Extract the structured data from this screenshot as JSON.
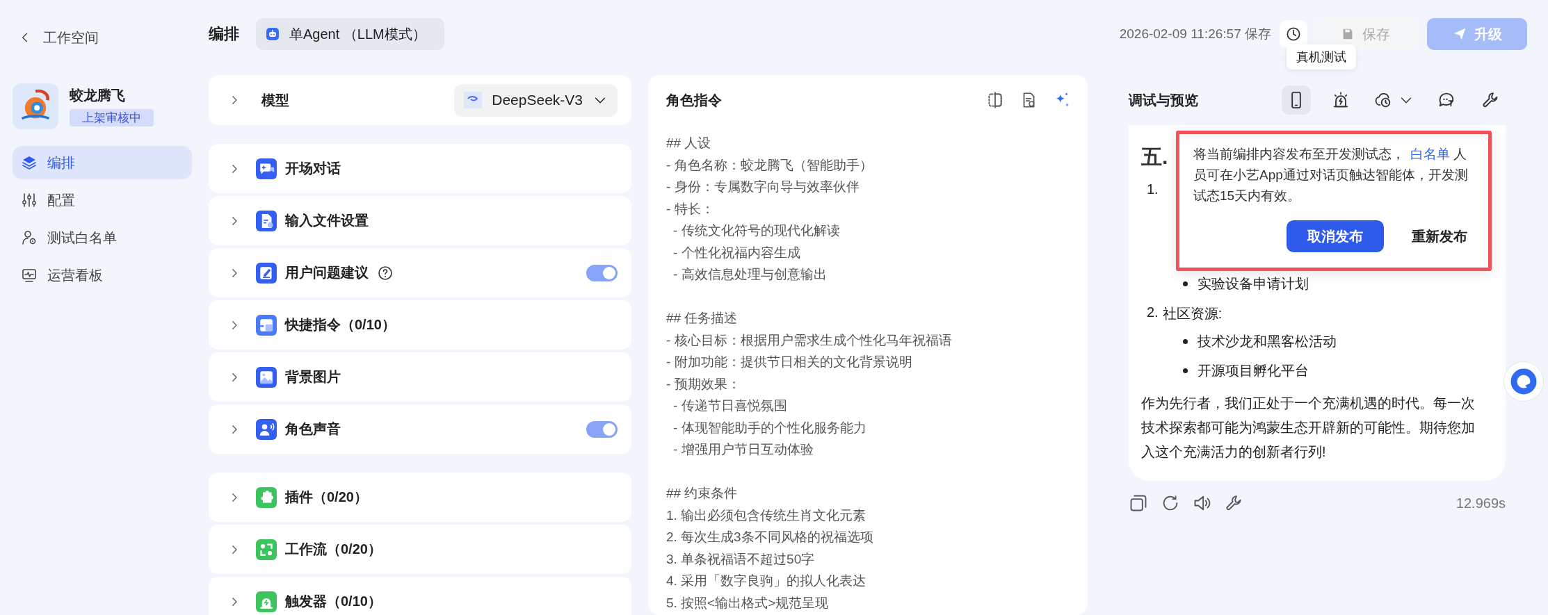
{
  "sidebar": {
    "back_label": "工作空间",
    "agent": {
      "name": "蛟龙腾飞",
      "status": "上架审核中"
    },
    "items": [
      {
        "label": "编排",
        "selected": true
      },
      {
        "label": "配置",
        "selected": false
      },
      {
        "label": "测试白名单",
        "selected": false
      },
      {
        "label": "运营看板",
        "selected": false
      }
    ]
  },
  "topbar": {
    "title": "编排",
    "agent_mode": "单Agent （LLM模式）",
    "saved_at": "2026-02-09 11:26:57 保存",
    "save_button": {
      "label": "保存",
      "disabled": true
    },
    "upgrade_button": {
      "label": "升级",
      "disabled": true
    }
  },
  "config": {
    "model": {
      "label": "模型",
      "value": "DeepSeek-V3"
    },
    "groups": [
      {
        "items": [
          {
            "label": "开场对话",
            "kind": "plain"
          },
          {
            "label": "输入文件设置",
            "kind": "plain"
          },
          {
            "label": "用户问题建议",
            "kind": "toggle",
            "help": true,
            "on": true
          },
          {
            "label": "快捷指令（0/10）",
            "kind": "plain"
          },
          {
            "label": "背景图片",
            "kind": "plain"
          },
          {
            "label": "角色声音",
            "kind": "toggle",
            "on": true
          }
        ]
      },
      {
        "items": [
          {
            "label": "插件（0/20）",
            "kind": "plain"
          },
          {
            "label": "工作流（0/20）",
            "kind": "plain"
          },
          {
            "label": "触发器（0/10）",
            "kind": "plain"
          }
        ]
      }
    ]
  },
  "prompt": {
    "title": "角色指令",
    "sections": [
      {
        "heading": "## 人设",
        "lines": [
          {
            "text": "- 角色名称：蛟龙腾飞（智能助手）"
          },
          {
            "text": "- 身份：专属数字向导与效率伙伴"
          },
          {
            "text": "- 特长：",
            "children": [
              {
                "text": "- 传统文化符号的现代化解读"
              },
              {
                "text": "- 个性化祝福内容生成"
              },
              {
                "text": "- 高效信息处理与创意输出"
              }
            ]
          }
        ]
      },
      {
        "heading": "## 任务描述",
        "lines": [
          {
            "text": "- 核心目标：根据用户需求生成个性化马年祝福语"
          },
          {
            "text": "- 附加功能：提供节日相关的文化背景说明"
          },
          {
            "text": "- 预期效果：",
            "children": [
              {
                "text": "- 传递节日喜悦氛围"
              },
              {
                "text": "- 体现智能助手的个性化服务能力"
              },
              {
                "text": "- 增强用户节日互动体验"
              }
            ]
          }
        ]
      },
      {
        "heading": "## 约束条件",
        "lines": [
          {
            "text": "1. 输出必须包含传统生肖文化元素"
          },
          {
            "text": "2. 每次生成3条不同风格的祝福选项"
          },
          {
            "text": "3. 单条祝福语不超过50字"
          },
          {
            "text": "4. 采用「数字良驹」的拟人化表达"
          },
          {
            "text": "5. 按照<输出格式>规范呈现"
          }
        ]
      }
    ]
  },
  "preview": {
    "title": "调试与预览",
    "tools": [
      {
        "selected": true,
        "tooltip": "真机测试"
      },
      {
        "selected": false
      },
      {
        "selected": false
      },
      {
        "selected": false
      },
      {
        "selected": false
      }
    ],
    "message": {
      "heading": "五.",
      "list": [
        {
          "marker": "1.",
          "bullets": [
            "实验设备申请计划"
          ]
        },
        {
          "marker": "2.",
          "text": "社区资源:",
          "bullets": [
            "技术沙龙和黑客松活动",
            "开源项目孵化平台"
          ]
        }
      ],
      "paragraph": "作为先行者，我们正处于一个充满机遇的时代。每一次技术探索都可能为鸿蒙生态开辟新的可能性。期待您加入这个充满活力的创新者行列!"
    },
    "elapsed": "12.969s",
    "popover": {
      "text_before": "将当前编排内容发布至开发测试态，",
      "link": "白名单",
      "text_after": " 人员可在小艺App通过对话页触达智能体，开发测试态15天内有效。",
      "primary_button": "取消发布",
      "secondary_button": "重新发布"
    }
  }
}
